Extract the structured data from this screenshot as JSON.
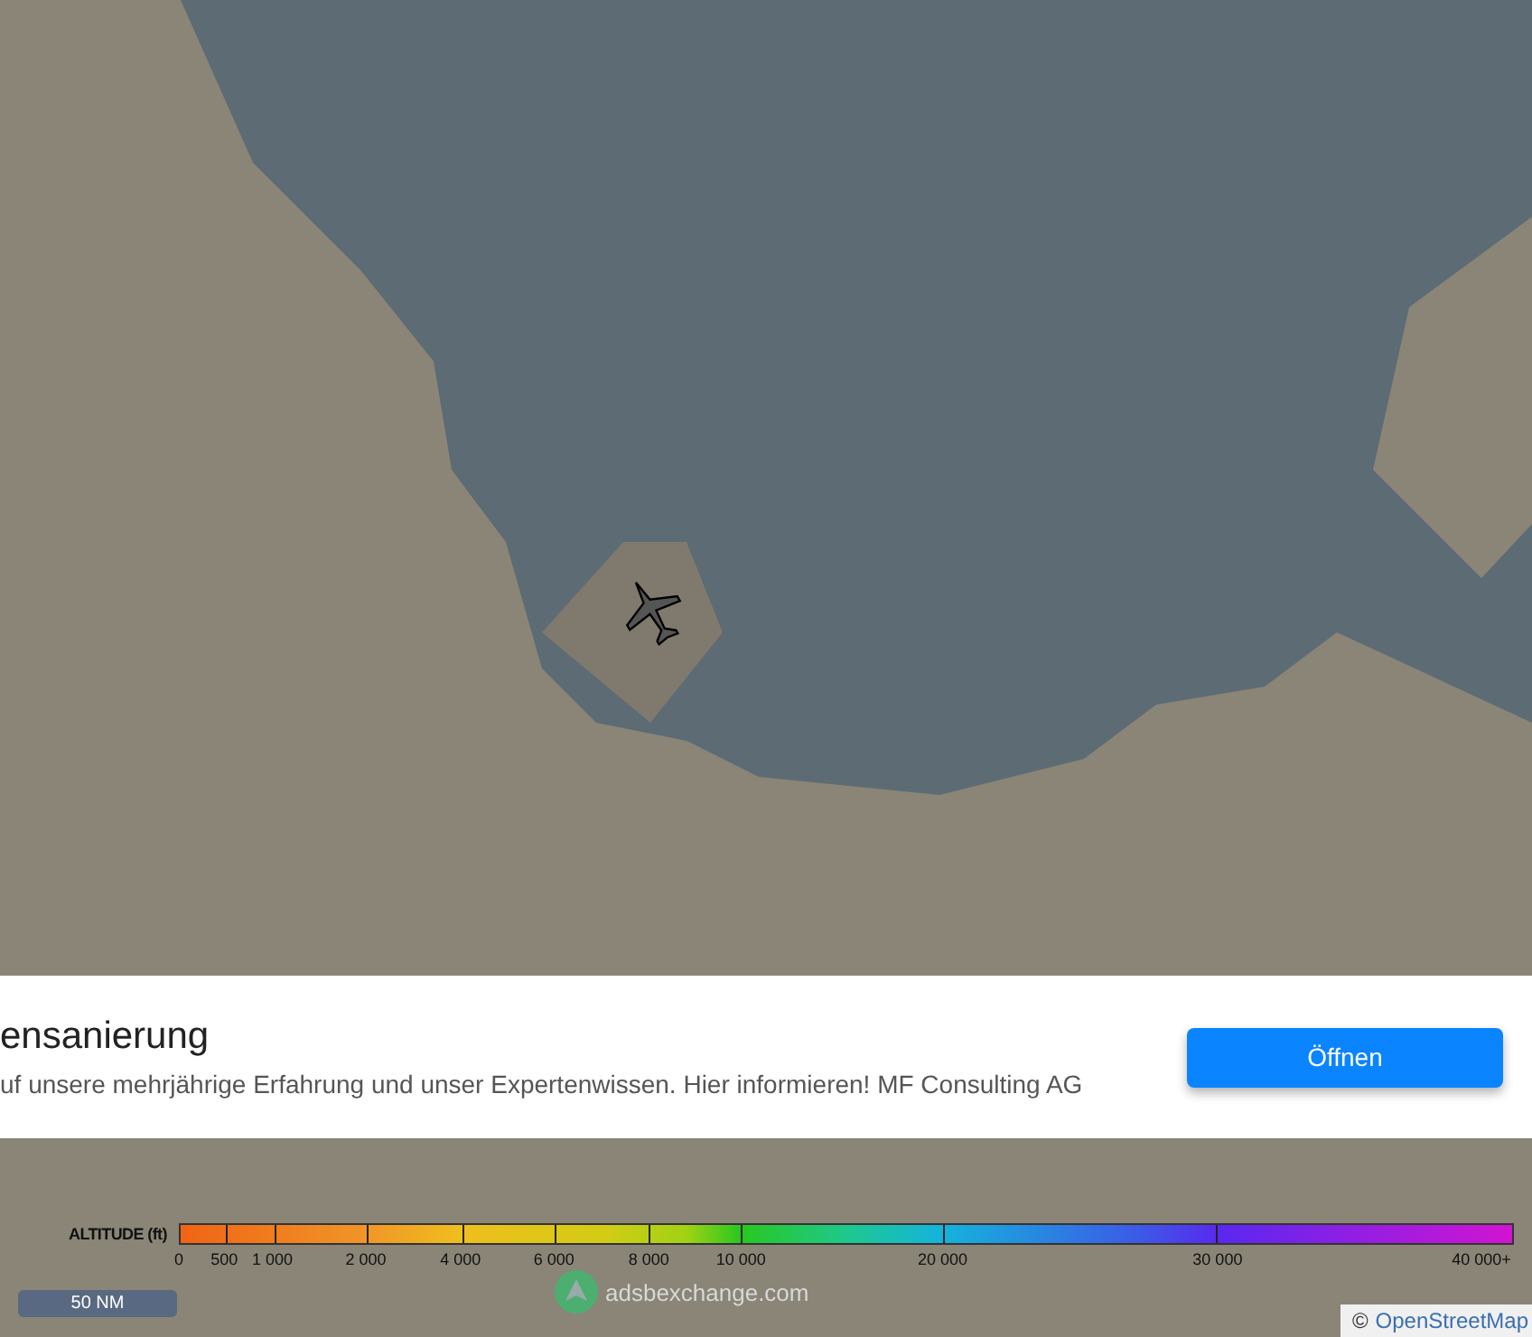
{
  "ad": {
    "title": "ensanierung",
    "text": "uf unsere mehrjährige Erfahrung und unser Expertenwissen. Hier informieren! MF Consulting AG",
    "button": "Öffnen"
  },
  "altitude_legend": {
    "label": "ALTITUDE (ft)",
    "ticks": [
      "0",
      "500",
      "1 000",
      "2 000",
      "4 000",
      "6 000",
      "8 000",
      "10 000",
      "20 000",
      "30 000",
      "40 000+"
    ]
  },
  "scale": {
    "label": "50 NM"
  },
  "logo": {
    "text": "adsbexchange.com"
  },
  "attribution": {
    "symbol": "©",
    "link": "OpenStreetMap"
  }
}
